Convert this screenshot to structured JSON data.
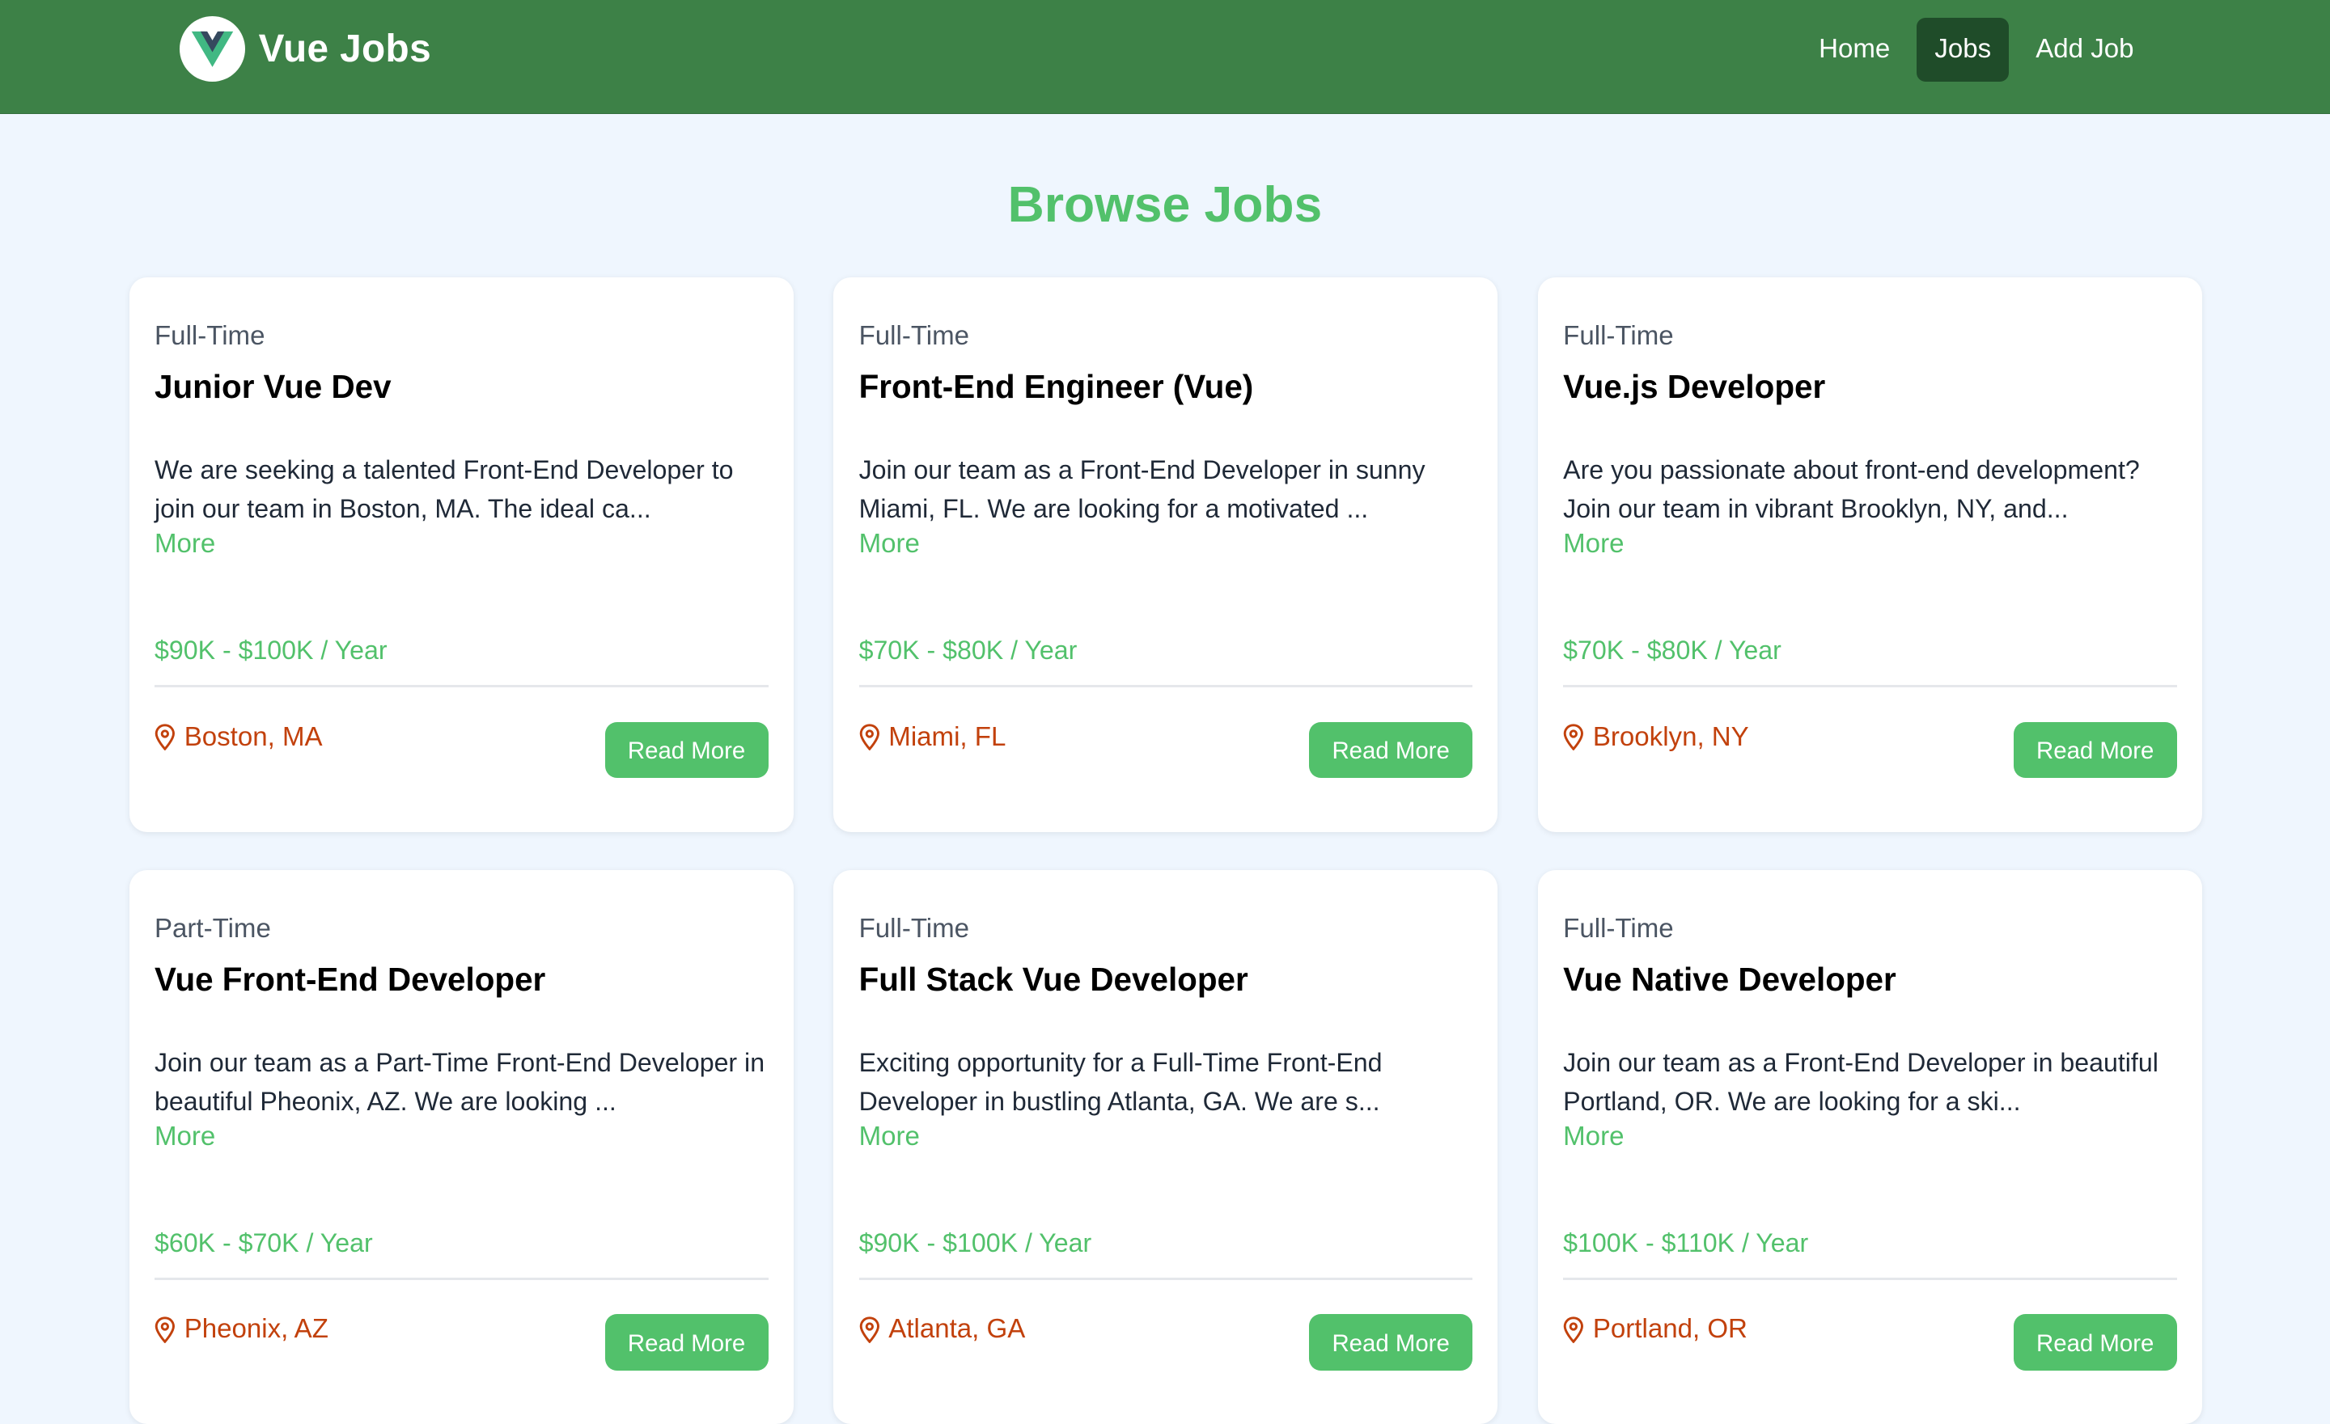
{
  "brand": {
    "name": "Vue Jobs",
    "logo_icon": "vue-logo-icon",
    "colors": {
      "navbar": "#3d8147",
      "accent": "#52c16b",
      "location": "#c2410c",
      "active_nav": "#1f4c29"
    }
  },
  "nav": {
    "items": [
      {
        "label": "Home",
        "active": false
      },
      {
        "label": "Jobs",
        "active": true
      },
      {
        "label": "Add Job",
        "active": false
      }
    ]
  },
  "page": {
    "title": "Browse Jobs"
  },
  "jobs": [
    {
      "type": "Full-Time",
      "title": "Junior Vue Dev",
      "description": "We are seeking a talented Front-End Developer to join our team in Boston, MA. The ideal ca...",
      "more_label": "More",
      "salary": "$90K - $100K / Year",
      "location": "Boston, MA",
      "button_label": "Read More"
    },
    {
      "type": "Full-Time",
      "title": "Front-End Engineer (Vue)",
      "description": "Join our team as a Front-End Developer in sunny Miami, FL. We are looking for a motivated ...",
      "more_label": "More",
      "salary": "$70K - $80K / Year",
      "location": "Miami, FL",
      "button_label": "Read More"
    },
    {
      "type": "Full-Time",
      "title": "Vue.js Developer",
      "description": "Are you passionate about front-end development? Join our team in vibrant Brooklyn, NY, and...",
      "more_label": "More",
      "salary": "$70K - $80K / Year",
      "location": "Brooklyn, NY",
      "button_label": "Read More"
    },
    {
      "type": "Part-Time",
      "title": "Vue Front-End Developer",
      "description": "Join our team as a Part-Time Front-End Developer in beautiful Pheonix, AZ. We are looking ...",
      "more_label": "More",
      "salary": "$60K - $70K / Year",
      "location": "Pheonix, AZ",
      "button_label": "Read More"
    },
    {
      "type": "Full-Time",
      "title": "Full Stack Vue Developer",
      "description": "Exciting opportunity for a Full-Time Front-End Developer in bustling Atlanta, GA. We are s...",
      "more_label": "More",
      "salary": "$90K - $100K / Year",
      "location": "Atlanta, GA",
      "button_label": "Read More"
    },
    {
      "type": "Full-Time",
      "title": "Vue Native Developer",
      "description": "Join our team as a Front-End Developer in beautiful Portland, OR. We are looking for a ski...",
      "more_label": "More",
      "salary": "$100K - $110K / Year",
      "location": "Portland, OR",
      "button_label": "Read More"
    }
  ]
}
